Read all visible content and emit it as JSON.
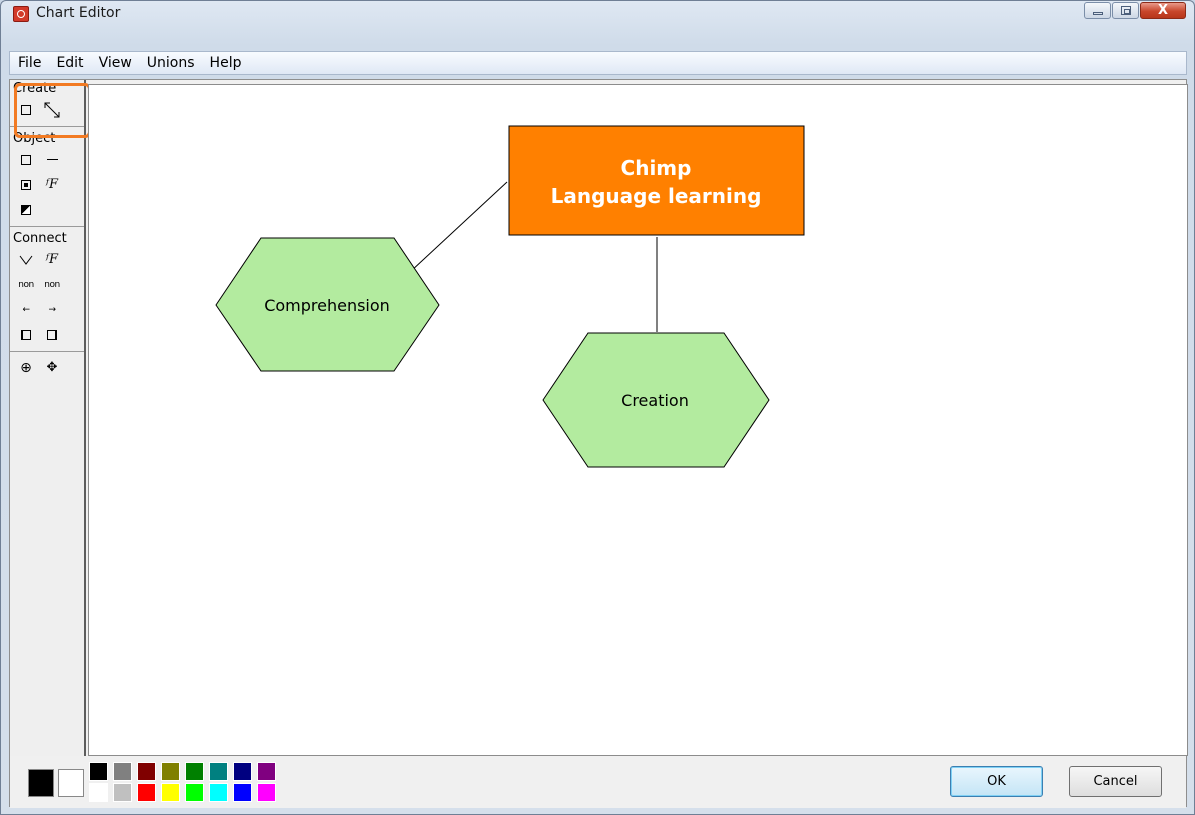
{
  "window": {
    "title": "Chart Editor"
  },
  "menu": {
    "items": [
      "File",
      "Edit",
      "View",
      "Unions",
      "Help"
    ]
  },
  "toolbox": {
    "create_label": "Create",
    "object_label": "Object",
    "connect_label": "Connect",
    "glyphs": {
      "f": "ᶠF",
      "non": "non",
      "arrow_left": "←",
      "arrow_right": "→",
      "zoom": "⊕",
      "move": "✥",
      "diag": "↖↘"
    }
  },
  "diagram": {
    "title_line1": "Chimp",
    "title_line2": "Language learning",
    "node1": "Comprehension",
    "node2": "Creation",
    "colors": {
      "title_fill": "#ff8000",
      "node_fill": "#b3eb9f"
    }
  },
  "palette": {
    "primary": "#000000",
    "secondary": "#ffffff",
    "row1": [
      "#000000",
      "#808080",
      "#800000",
      "#808000",
      "#008000",
      "#008080",
      "#000080",
      "#800080"
    ],
    "row2": [
      "#ffffff",
      "#c0c0c0",
      "#ff0000",
      "#ffff00",
      "#00ff00",
      "#00ffff",
      "#0000ff",
      "#ff00ff"
    ]
  },
  "buttons": {
    "ok": "OK",
    "cancel": "Cancel"
  }
}
